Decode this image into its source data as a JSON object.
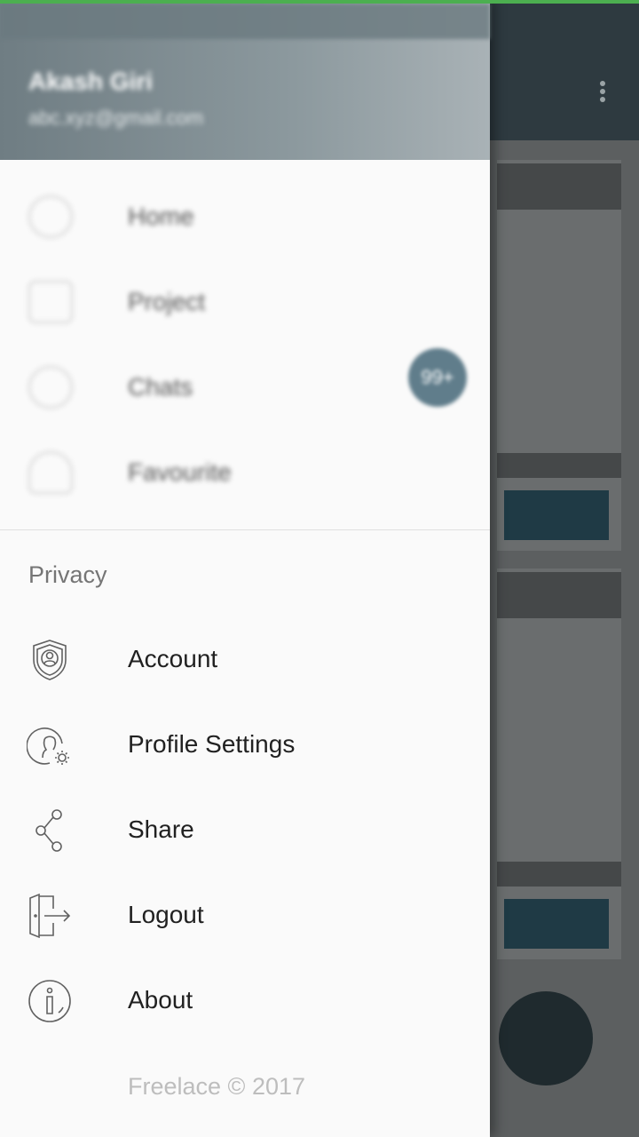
{
  "header": {
    "user_name": "Akash Giri",
    "user_email": "abc.xyz@gmail.com"
  },
  "nav_items": [
    {
      "label": "Home",
      "icon": "home-icon"
    },
    {
      "label": "Project",
      "icon": "project-icon"
    },
    {
      "label": "Chats",
      "icon": "chat-icon"
    },
    {
      "label": "Favourite",
      "icon": "favourite-icon"
    }
  ],
  "chat_badge": "99+",
  "privacy": {
    "title": "Privacy",
    "items": [
      {
        "label": "Account",
        "icon": "shield-user-icon"
      },
      {
        "label": "Profile Settings",
        "icon": "profile-settings-icon"
      },
      {
        "label": "Share",
        "icon": "share-icon"
      },
      {
        "label": "Logout",
        "icon": "logout-icon"
      },
      {
        "label": "About",
        "icon": "info-icon"
      }
    ]
  },
  "footer": "Freelace © 2017",
  "colors": {
    "status_accent": "#4caf50",
    "header_gradient_start": "#6f7d83",
    "badge": "#607d8b",
    "icon_stroke": "#616161"
  }
}
